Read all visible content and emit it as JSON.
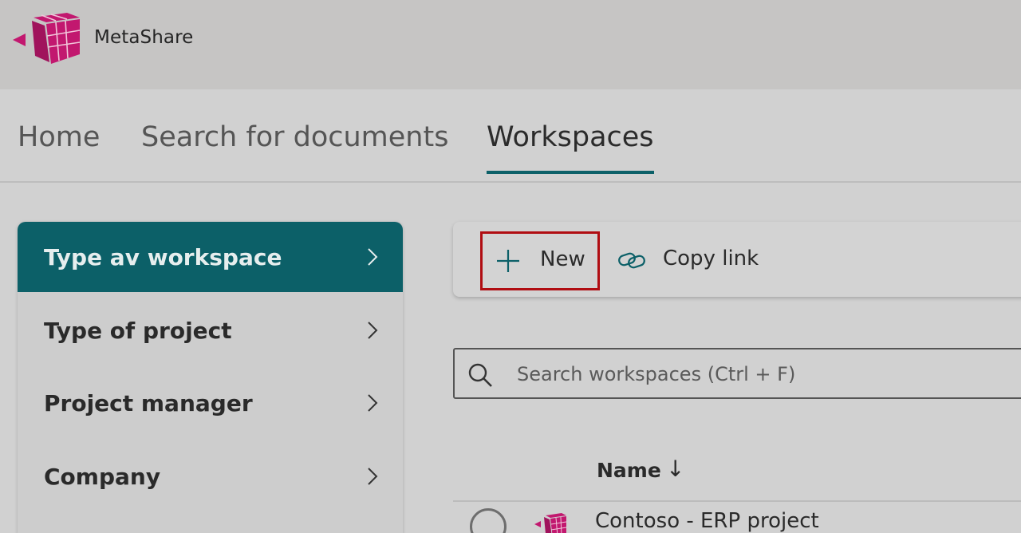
{
  "app": {
    "name": "MetaShare",
    "logo_icon": "cube-grid-logo",
    "brand_color": "#c2186f"
  },
  "nav": {
    "tabs": [
      {
        "label": "Home",
        "active": false
      },
      {
        "label": "Search for documents",
        "active": false
      },
      {
        "label": "Workspaces",
        "active": true
      }
    ],
    "accent_color": "#0c6068"
  },
  "sidebar": {
    "items": [
      {
        "label": "Type av workspace",
        "active": true
      },
      {
        "label": "Type of project",
        "active": false
      },
      {
        "label": "Project manager",
        "active": false
      },
      {
        "label": "Company",
        "active": false
      }
    ]
  },
  "toolbar": {
    "new_label": "New",
    "new_icon": "plus-icon",
    "copy_link_label": "Copy link",
    "copy_link_icon": "link-icon",
    "highlight_color": "#b00d12"
  },
  "search": {
    "placeholder": "Search workspaces (Ctrl + F)",
    "value": ""
  },
  "list": {
    "columns": [
      {
        "label": "Name",
        "sort": "descending",
        "sort_glyph": "↓"
      }
    ],
    "rows": [
      {
        "name": "Contoso - ERP project",
        "selected": false
      }
    ]
  }
}
